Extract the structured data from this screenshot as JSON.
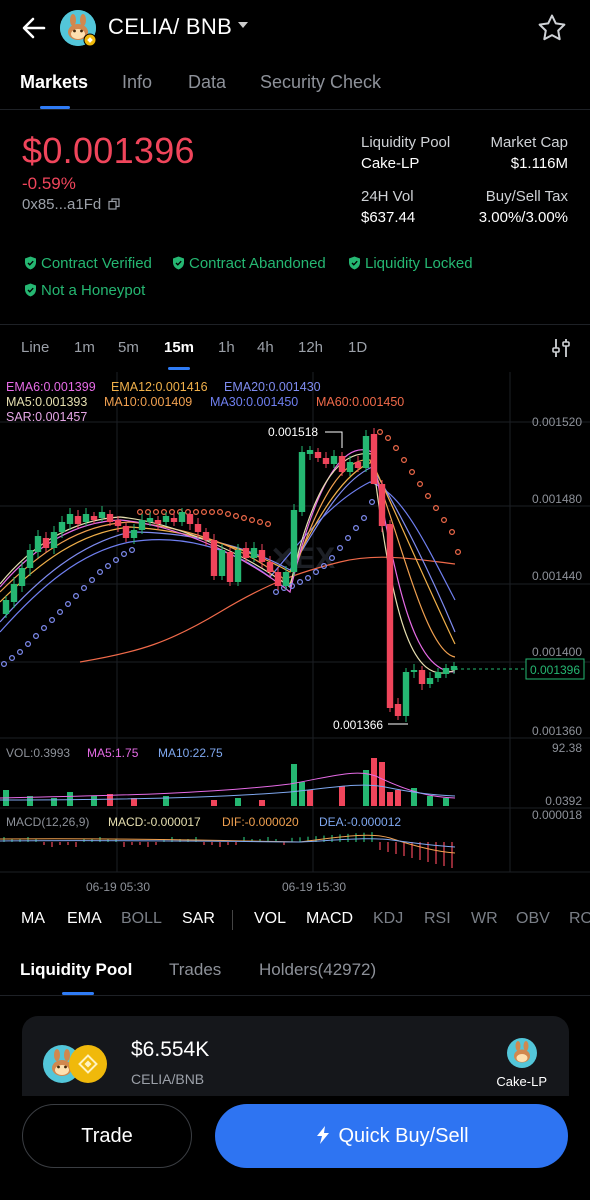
{
  "header": {
    "pair": "CELIA/ BNB",
    "back_icon": "arrow-left-icon",
    "star_icon": "star-outline-icon"
  },
  "tabs": [
    "Markets",
    "Info",
    "Data",
    "Security Check"
  ],
  "price": {
    "value": "$0.001396",
    "change": "-0.59%",
    "address": "0x85...a1Fd"
  },
  "stats": {
    "liquidity_pool_label": "Liquidity Pool",
    "liquidity_pool_value": "Cake-LP",
    "market_cap_label": "Market Cap",
    "market_cap_value": "$1.116M",
    "vol_label": "24H Vol",
    "vol_value": "$637.44",
    "tax_label": "Buy/Sell Tax",
    "tax_value": "3.00%/3.00%"
  },
  "badges": [
    "Contract Verified",
    "Contract Abandoned",
    "Liquidity Locked",
    "Not a Honeypot"
  ],
  "chart_tabs": [
    "Line",
    "1m",
    "5m",
    "15m",
    "1h",
    "4h",
    "12h",
    "1D"
  ],
  "legend": {
    "ema6": "EMA6:0.001399",
    "ema12": "EMA12:0.001416",
    "ema20": "EMA20:0.001430",
    "ma5": "MA5:0.001393",
    "ma10": "MA10:0.001409",
    "ma30": "MA30:0.001450",
    "ma60": "MA60:0.001450",
    "sar": "SAR:0.001457"
  },
  "axis": {
    "p1": "0.001520",
    "p2": "0.001480",
    "p3": "0.001440",
    "p4": "0.001400",
    "p5": "0.001360",
    "current": "0.001396",
    "high": "0.001518",
    "low": "0.001366",
    "vol_max": "92.38",
    "vol_mid": "0.0392",
    "macd_top": "0.000018",
    "time1": "06-19 05:30",
    "time2": "06-19 15:30"
  },
  "volume_legend": {
    "vol": "VOL:0.3993",
    "ma5": "MA5:1.75",
    "ma10": "MA10:22.75"
  },
  "macd_legend": {
    "name": "MACD(12,26,9)",
    "macd": "MACD:-0.000017",
    "dif": "DIF:-0.000020",
    "dea": "DEA:-0.000012"
  },
  "indicators": [
    "MA",
    "EMA",
    "BOLL",
    "SAR",
    "VOL",
    "MACD",
    "KDJ",
    "RSI",
    "WR",
    "OBV",
    "RO"
  ],
  "bottom_tabs": [
    "Liquidity Pool",
    "Trades",
    "Holders(42972)"
  ],
  "pool_card": {
    "value": "$6.554K",
    "pair": "CELIA/BNB",
    "lp": "Cake-LP"
  },
  "footer": {
    "trade": "Trade",
    "quick": "Quick Buy/Sell",
    "bolt_icon": "lightning-bolt-icon"
  },
  "colors": {
    "up": "#25b772",
    "down": "#f0455b",
    "accent": "#2e74f2"
  }
}
